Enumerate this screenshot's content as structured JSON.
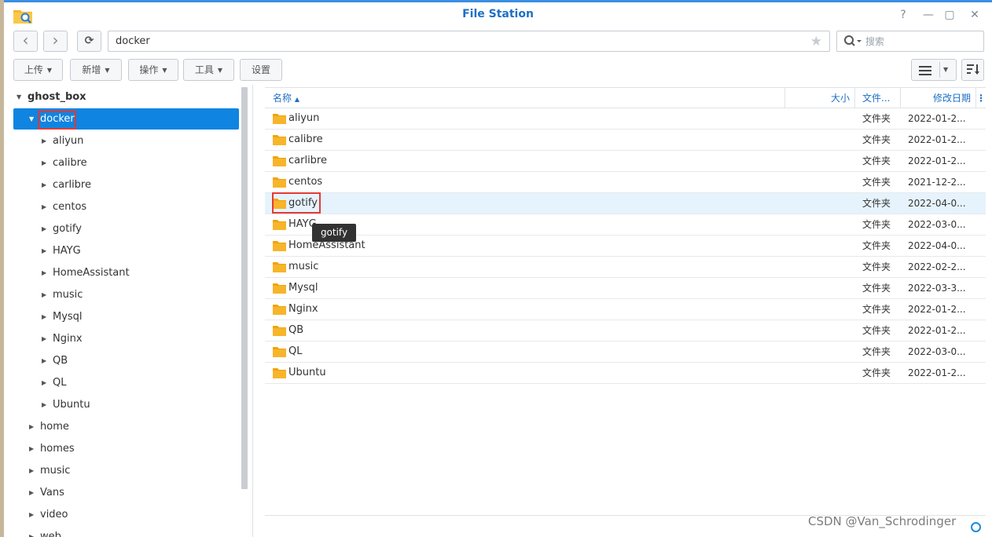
{
  "window": {
    "title": "File Station",
    "controls": [
      "?",
      "—",
      "▢",
      "✕"
    ]
  },
  "nav": {
    "back": "‹",
    "forward": "›",
    "refresh": "⟳",
    "path": "docker",
    "search_placeholder": "搜索"
  },
  "toolbar": {
    "upload": "上传",
    "create": "新增",
    "action": "操作",
    "tools": "工具",
    "settings": "设置"
  },
  "tree": {
    "root": "ghost_box",
    "selected": "docker",
    "docker_children": [
      "aliyun",
      "calibre",
      "carlibre",
      "centos",
      "gotify",
      "HAYG",
      "HomeAssistant",
      "music",
      "Mysql",
      "Nginx",
      "QB",
      "QL",
      "Ubuntu"
    ],
    "siblings": [
      "home",
      "homes",
      "music",
      "Vans",
      "video",
      "web"
    ]
  },
  "columns": {
    "name": "名称",
    "size": "大小",
    "type": "文件...",
    "modified": "修改日期"
  },
  "files": [
    {
      "name": "aliyun",
      "type": "文件夹",
      "modified": "2022-01-2..."
    },
    {
      "name": "calibre",
      "type": "文件夹",
      "modified": "2022-01-2..."
    },
    {
      "name": "carlibre",
      "type": "文件夹",
      "modified": "2022-01-2..."
    },
    {
      "name": "centos",
      "type": "文件夹",
      "modified": "2021-12-2..."
    },
    {
      "name": "gotify",
      "type": "文件夹",
      "modified": "2022-04-0..."
    },
    {
      "name": "HAYG",
      "type": "文件夹",
      "modified": "2022-03-0..."
    },
    {
      "name": "HomeAssistant",
      "type": "文件夹",
      "modified": "2022-04-0..."
    },
    {
      "name": "music",
      "type": "文件夹",
      "modified": "2022-02-2..."
    },
    {
      "name": "Mysql",
      "type": "文件夹",
      "modified": "2022-03-3..."
    },
    {
      "name": "Nginx",
      "type": "文件夹",
      "modified": "2022-01-2..."
    },
    {
      "name": "QB",
      "type": "文件夹",
      "modified": "2022-01-2..."
    },
    {
      "name": "QL",
      "type": "文件夹",
      "modified": "2022-03-0..."
    },
    {
      "name": "Ubuntu",
      "type": "文件夹",
      "modified": "2022-01-2..."
    }
  ],
  "tooltip": "gotify",
  "watermark": "CSDN @Van_Schrodinger",
  "colors": {
    "accent": "#0f84e0",
    "title": "#1d6fc6",
    "folder": "#f5a623",
    "highlight": "#e53935"
  }
}
